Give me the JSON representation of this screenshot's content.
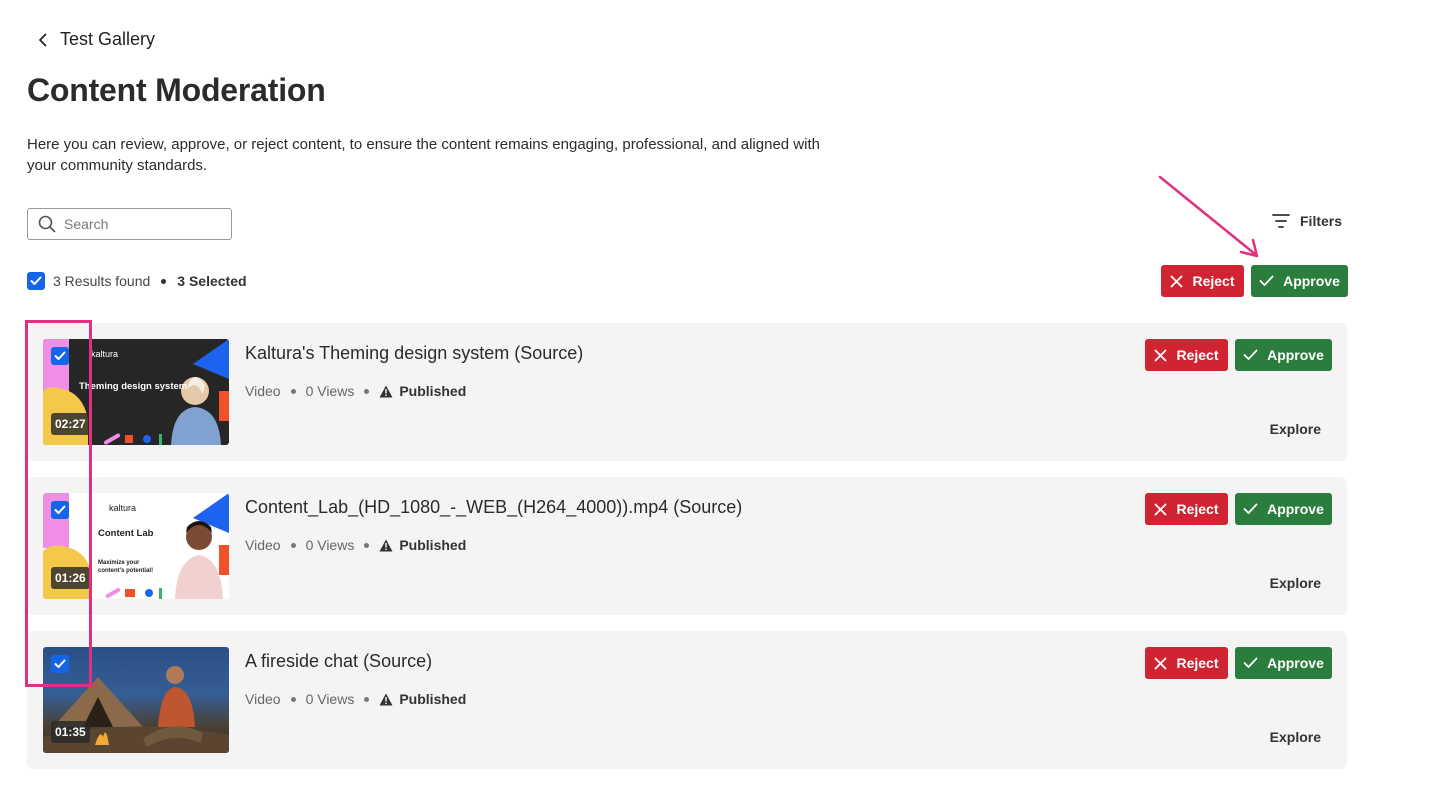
{
  "nav": {
    "back_label": "Test Gallery"
  },
  "page": {
    "title": "Content Moderation",
    "description": "Here you can review, approve, or reject content, to ensure the content remains engaging, professional, and aligned with your community standards."
  },
  "search": {
    "placeholder": "Search",
    "value": ""
  },
  "filters": {
    "label": "Filters"
  },
  "results": {
    "found_text": "3 Results found",
    "selected_text": "3 Selected",
    "all_checked": true
  },
  "bulk_actions": {
    "reject_label": "Reject",
    "approve_label": "Approve"
  },
  "entries": [
    {
      "title": "Kaltura's Theming design system (Source)",
      "type": "Video",
      "views": "0 Views",
      "status": "Published",
      "duration": "02:27",
      "thumb_brand": "kaltura",
      "thumb_heading": "Theming design system",
      "reject_label": "Reject",
      "approve_label": "Approve",
      "explore_label": "Explore",
      "checked": true
    },
    {
      "title": "Content_Lab_(HD_1080_-_WEB_(H264_4000)).mp4 (Source)",
      "type": "Video",
      "views": "0 Views",
      "status": "Published",
      "duration": "01:26",
      "thumb_brand": "kaltura",
      "thumb_heading": "Content Lab",
      "thumb_sub": "Maximize your content's potential!",
      "reject_label": "Reject",
      "approve_label": "Approve",
      "explore_label": "Explore",
      "checked": true
    },
    {
      "title": "A fireside chat (Source)",
      "type": "Video",
      "views": "0 Views",
      "status": "Published",
      "duration": "01:35",
      "reject_label": "Reject",
      "approve_label": "Approve",
      "explore_label": "Explore",
      "checked": true
    }
  ],
  "colors": {
    "reject": "#d02433",
    "approve": "#2b7d3d",
    "checkbox": "#1565e8",
    "annotation": "#e0307f",
    "card_bg": "#f4f4f4"
  }
}
